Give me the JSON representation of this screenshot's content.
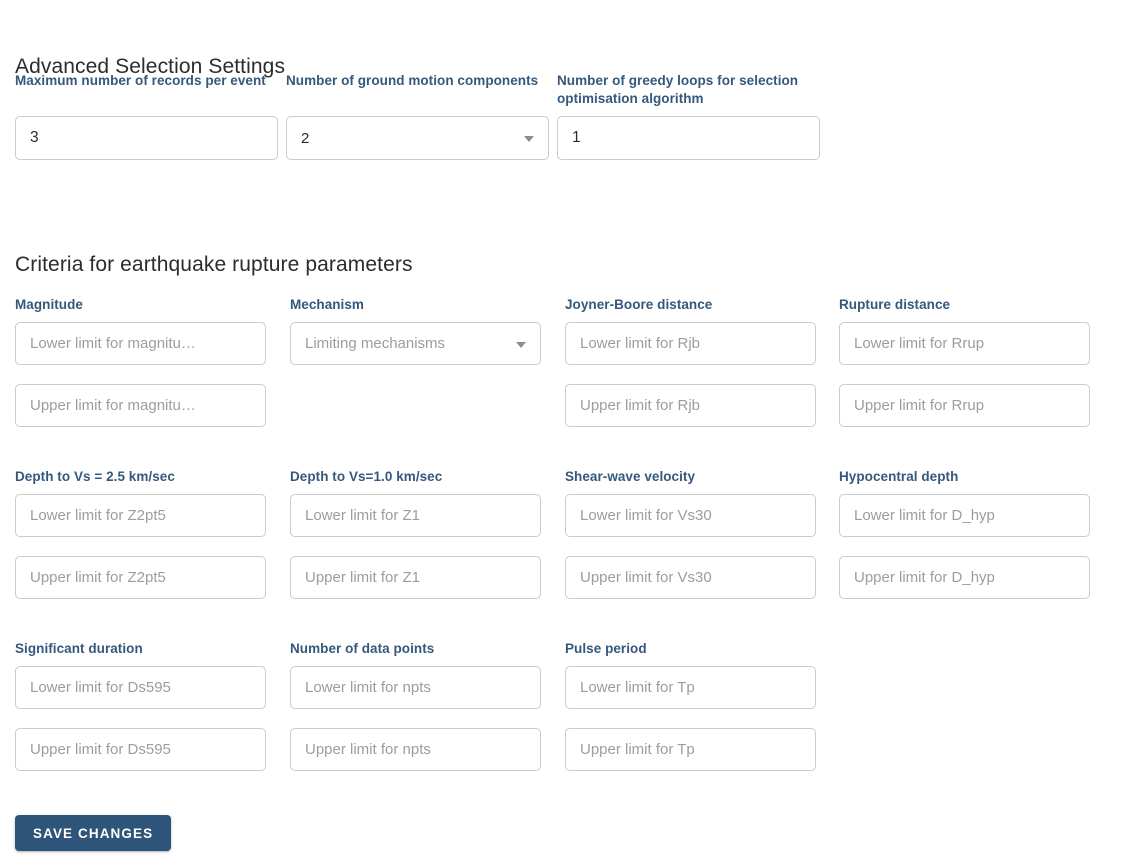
{
  "sections": {
    "advanced": {
      "heading": "Advanced Selection Settings",
      "fields": [
        {
          "label": "Maximum number of records per event",
          "type": "text",
          "value": "3",
          "placeholder": ""
        },
        {
          "label": "Number of ground motion components",
          "type": "select",
          "value": "2",
          "caret": "chevron-down-icon"
        },
        {
          "label": "Number of greedy loops for selection optimisation algorithm",
          "type": "text",
          "value": "1",
          "placeholder": ""
        }
      ]
    },
    "criteria": {
      "heading": "Criteria for earthquake rupture parameters",
      "rows": [
        {
          "columns": [
            {
              "label": "Magnitude",
              "lower": {
                "type": "text",
                "value": "",
                "placeholder": "Lower limit for magnitu…"
              },
              "upper": {
                "type": "text",
                "value": "",
                "placeholder": "Upper limit for magnitu…"
              }
            },
            {
              "label": "Mechanism",
              "lower": {
                "type": "select",
                "value": "",
                "placeholder": "Limiting mechanisms",
                "caret": "chevron-down-icon"
              },
              "upper": null
            },
            {
              "label": "Joyner-Boore distance",
              "lower": {
                "type": "text",
                "value": "",
                "placeholder": "Lower limit for Rjb"
              },
              "upper": {
                "type": "text",
                "value": "",
                "placeholder": "Upper limit for Rjb"
              }
            },
            {
              "label": "Rupture distance",
              "lower": {
                "type": "text",
                "value": "",
                "placeholder": "Lower limit for Rrup"
              },
              "upper": {
                "type": "text",
                "value": "",
                "placeholder": "Upper limit for Rrup"
              }
            }
          ]
        },
        {
          "columns": [
            {
              "label": "Depth to Vs = 2.5 km/sec",
              "lower": {
                "type": "text",
                "value": "",
                "placeholder": "Lower limit for Z2pt5"
              },
              "upper": {
                "type": "text",
                "value": "",
                "placeholder": "Upper limit for Z2pt5"
              }
            },
            {
              "label": "Depth to Vs=1.0 km/sec",
              "lower": {
                "type": "text",
                "value": "",
                "placeholder": "Lower limit for Z1"
              },
              "upper": {
                "type": "text",
                "value": "",
                "placeholder": "Upper limit for Z1"
              }
            },
            {
              "label": "Shear-wave velocity",
              "lower": {
                "type": "text",
                "value": "",
                "placeholder": "Lower limit for Vs30"
              },
              "upper": {
                "type": "text",
                "value": "",
                "placeholder": "Upper limit for Vs30"
              }
            },
            {
              "label": "Hypocentral depth",
              "lower": {
                "type": "text",
                "value": "",
                "placeholder": "Lower limit for D_hyp"
              },
              "upper": {
                "type": "text",
                "value": "",
                "placeholder": "Upper limit for D_hyp"
              }
            }
          ]
        },
        {
          "columns": [
            {
              "label": "Significant duration",
              "lower": {
                "type": "text",
                "value": "",
                "placeholder": "Lower limit for Ds595"
              },
              "upper": {
                "type": "text",
                "value": "",
                "placeholder": "Upper limit for Ds595"
              }
            },
            {
              "label": "Number of data points",
              "lower": {
                "type": "text",
                "value": "",
                "placeholder": "Lower limit for npts"
              },
              "upper": {
                "type": "text",
                "value": "",
                "placeholder": "Upper limit for npts"
              }
            },
            {
              "label": "Pulse period",
              "lower": {
                "type": "text",
                "value": "",
                "placeholder": "Lower limit for Tp"
              },
              "upper": {
                "type": "text",
                "value": "",
                "placeholder": "Upper limit for Tp"
              }
            },
            null
          ]
        }
      ]
    }
  },
  "actions": {
    "save_label": "Save changes"
  },
  "colors": {
    "label_blue": "#35587d",
    "button_blue": "#2f5479",
    "heading_gray": "#2c2c2c",
    "placeholder_gray": "#9a9da1",
    "border_gray": "#c9cbcd"
  }
}
